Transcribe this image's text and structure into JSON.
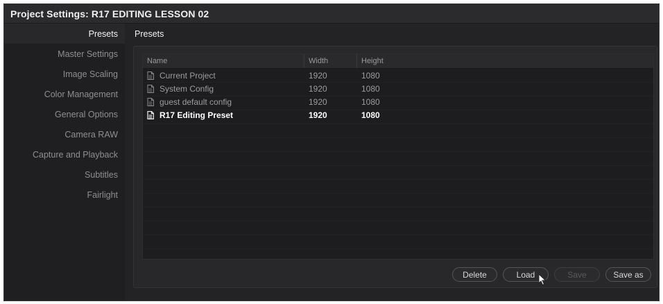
{
  "window": {
    "title": "Project Settings:  R17 EDITING LESSON 02"
  },
  "sidebar": {
    "items": [
      {
        "label": "Presets",
        "active": true
      },
      {
        "label": "Master Settings"
      },
      {
        "label": "Image Scaling"
      },
      {
        "label": "Color Management"
      },
      {
        "label": "General Options"
      },
      {
        "label": "Camera RAW"
      },
      {
        "label": "Capture and Playback"
      },
      {
        "label": "Subtitles"
      },
      {
        "label": "Fairlight"
      }
    ]
  },
  "panel": {
    "title": "Presets"
  },
  "table": {
    "columns": {
      "name": "Name",
      "width": "Width",
      "height": "Height"
    },
    "rows": [
      {
        "name": "Current Project",
        "width": "1920",
        "height": "1080"
      },
      {
        "name": "System Config",
        "width": "1920",
        "height": "1080"
      },
      {
        "name": "guest default config",
        "width": "1920",
        "height": "1080"
      },
      {
        "name": "R17 Editing Preset",
        "width": "1920",
        "height": "1080",
        "selected": true
      }
    ]
  },
  "buttons": {
    "delete": "Delete",
    "load": "Load",
    "save": "Save",
    "save_as": "Save as"
  },
  "icons": {
    "row_icon": "document-icon",
    "cursor": "pointer-cursor-icon"
  }
}
